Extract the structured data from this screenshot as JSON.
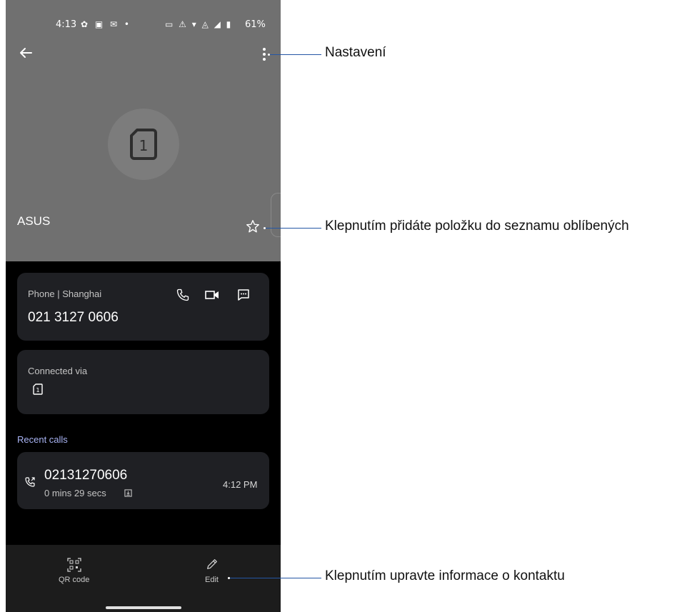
{
  "status_bar": {
    "time": "4:13",
    "battery": "61%"
  },
  "contact": {
    "name": "ASUS"
  },
  "phone_card": {
    "type_label": "Phone | Shanghai",
    "number": "021 3127 0606"
  },
  "connected_card": {
    "label": "Connected via",
    "sim_number": "1"
  },
  "recent": {
    "heading": "Recent calls",
    "calls": [
      {
        "number": "02131270606",
        "duration": "0 mins 29 secs",
        "time": "4:12 PM"
      }
    ]
  },
  "bottom_bar": {
    "qr_label": "QR code",
    "edit_label": "Edit"
  },
  "callouts": {
    "settings": "Nastavení",
    "favorite": "Klepnutím přidáte položku do seznamu oblíbených",
    "edit": "Klepnutím upravte informace o kontaktu"
  },
  "colors": {
    "header_bg": "#707070",
    "card_bg": "#1f2024",
    "accent": "#a9b4f4",
    "callout_line": "#2456a4"
  }
}
